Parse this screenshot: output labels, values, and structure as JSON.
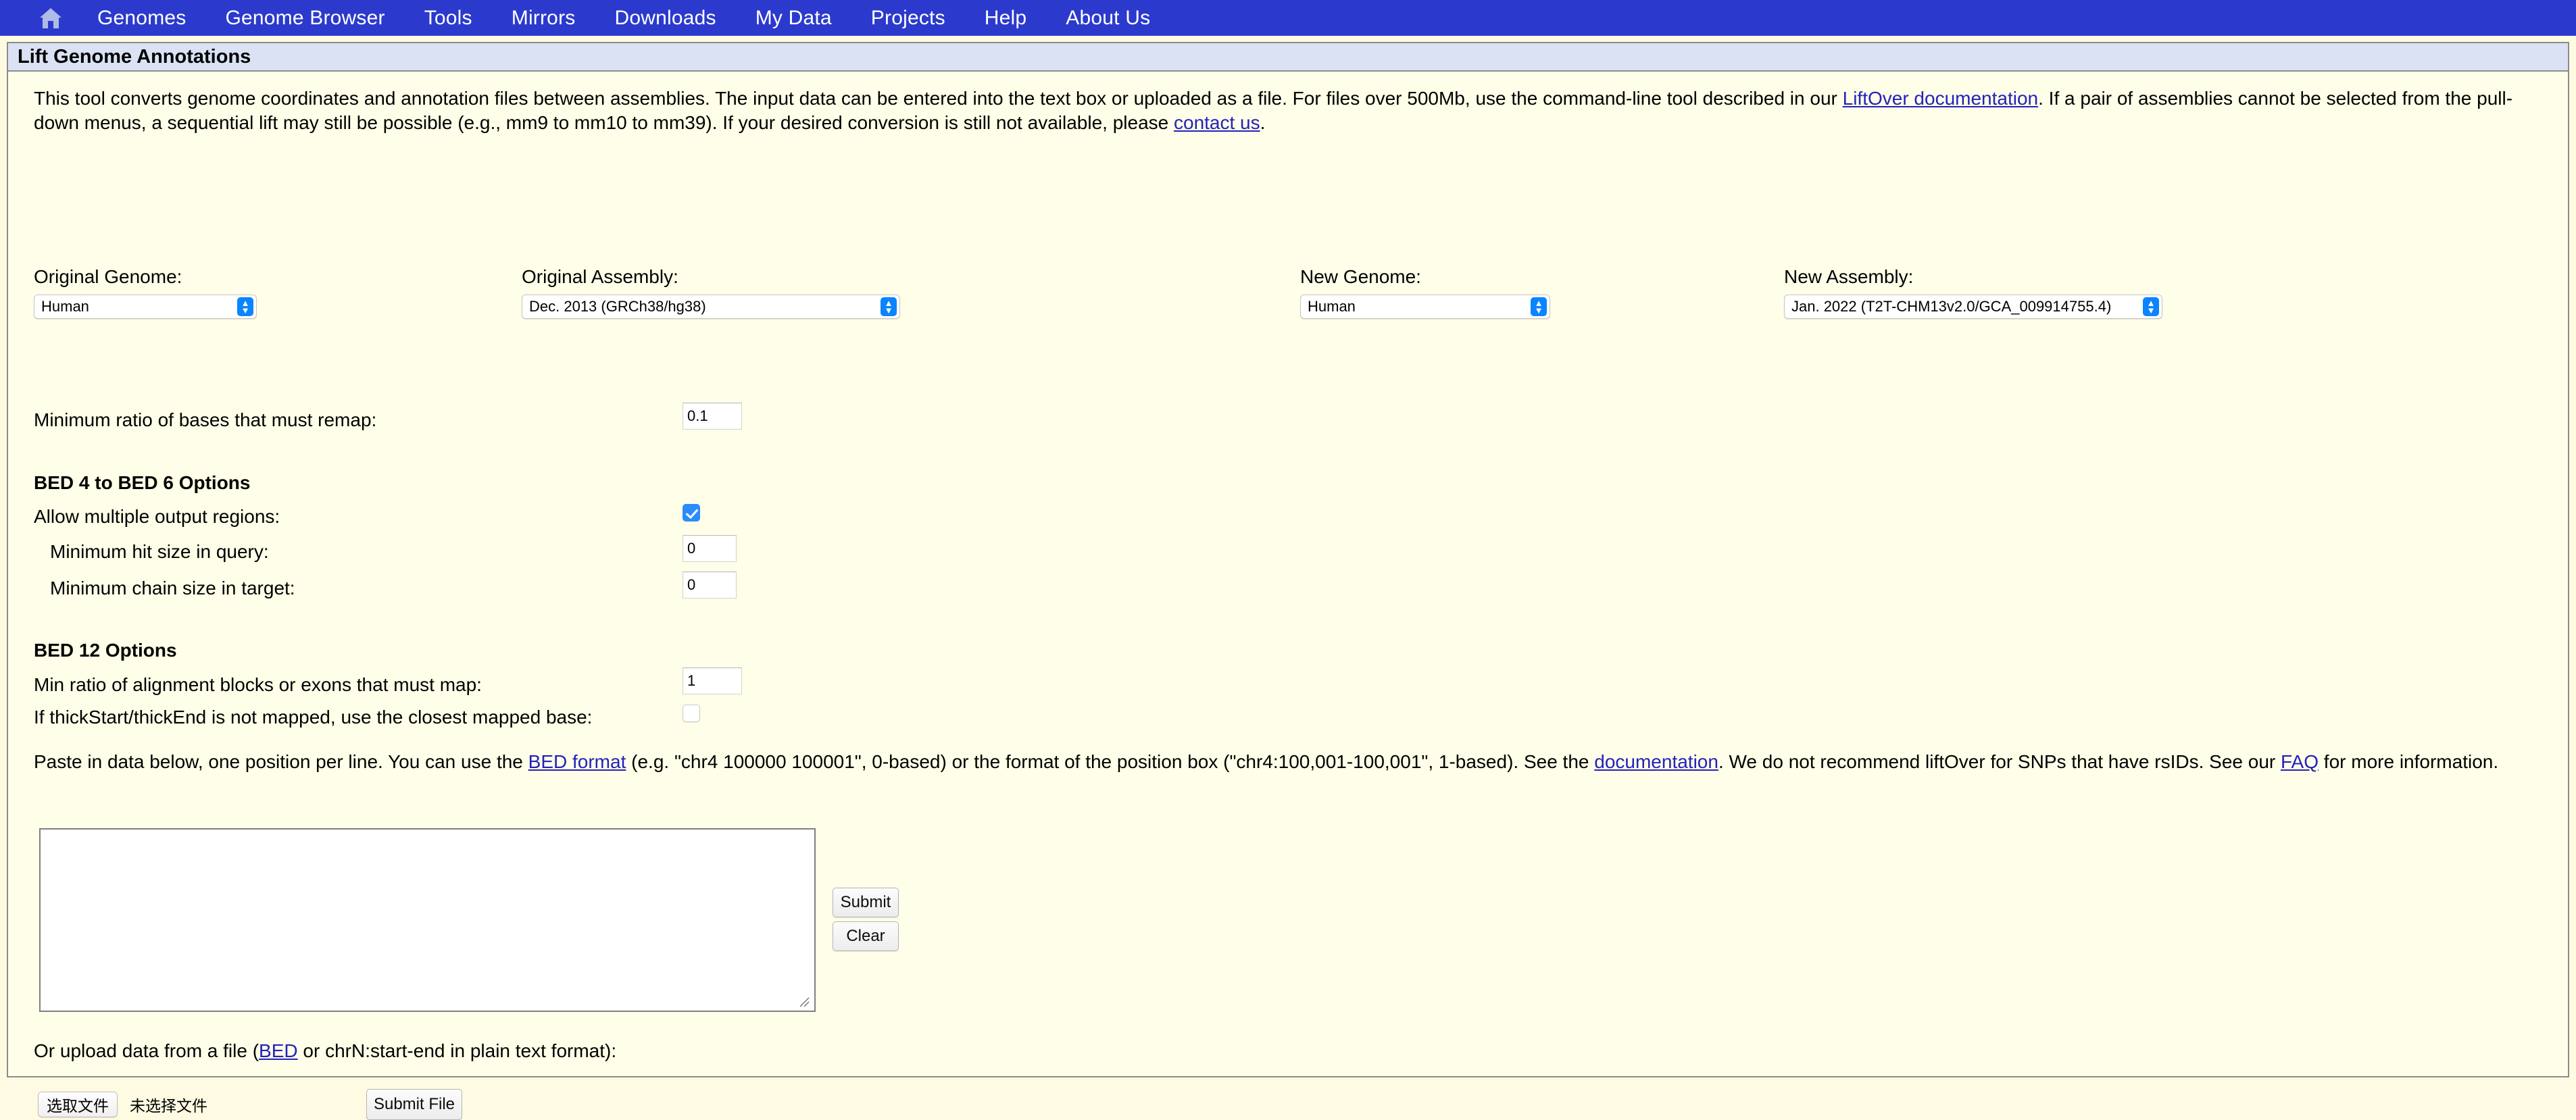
{
  "nav": {
    "home_icon": "home-icon",
    "items": [
      {
        "label": "Genomes"
      },
      {
        "label": "Genome Browser"
      },
      {
        "label": "Tools"
      },
      {
        "label": "Mirrors"
      },
      {
        "label": "Downloads"
      },
      {
        "label": "My Data"
      },
      {
        "label": "Projects"
      },
      {
        "label": "Help"
      },
      {
        "label": "About Us"
      }
    ]
  },
  "page": {
    "title": "Lift Genome Annotations"
  },
  "intro": {
    "t1": "This tool converts genome coordinates and annotation files between assemblies.  The input data can be entered into the text box or uploaded as a file.  For files over 500Mb, use the command-line tool described in our ",
    "link1": "LiftOver documentation",
    "t2": ".  If a pair of assemblies cannot be selected from the pull-down menus, a sequential lift may still be possible (e.g., mm9 to mm10 to mm39).  If your desired conversion is still not available, please ",
    "link2": "contact us",
    "t3": "."
  },
  "selectors": {
    "orig_genome_label": "Original Genome:",
    "orig_genome_value": "Human",
    "orig_assembly_label": "Original Assembly:",
    "orig_assembly_value": "Dec. 2013 (GRCh38/hg38)",
    "new_genome_label": "New Genome:",
    "new_genome_value": "Human",
    "new_assembly_label": "New Assembly:",
    "new_assembly_value": "Jan. 2022 (T2T-CHM13v2.0/GCA_009914755.4)"
  },
  "options": {
    "min_ratio_label": "Minimum ratio of bases that must remap:",
    "min_ratio_value": "0.1",
    "bed46_heading": "BED 4 to BED 6 Options",
    "allow_multi_label": "Allow multiple output regions:",
    "allow_multi_checked": "true",
    "min_hit_label": "Minimum hit size in query:",
    "min_hit_value": "0",
    "min_chain_label": "Minimum chain size in target:",
    "min_chain_value": "0",
    "bed12_heading": "BED 12 Options",
    "min_ratio_aln_label": "Min ratio of alignment blocks or exons that must map:",
    "min_ratio_aln_value": "1",
    "thickstart_label": "If thickStart/thickEnd is not mapped, use the closest mapped base:",
    "thickstart_checked": "false"
  },
  "paste": {
    "t1": "Paste in data below, one position per line. You can use the ",
    "link1": "BED format",
    "t2": " (e.g. \"chr4 100000 100001\", 0-based) or the format of the position box (\"chr4:100,001-100,001\", 1-based). See the ",
    "link2": "documentation",
    "t3": ". We do not recommend liftOver for SNPs that have rsIDs. See our ",
    "link3": "FAQ",
    "t4": " for more information."
  },
  "form": {
    "textarea_value": "",
    "textarea_placeholder": "",
    "submit_label": "Submit",
    "clear_label": "Clear"
  },
  "upload": {
    "t1": "Or upload data from a file (",
    "link1": "BED",
    "t2": " or chrN:start-end in plain text format):",
    "choose_file_label": "选取文件",
    "file_status": "未选择文件",
    "submit_file_label": "Submit File"
  },
  "colors": {
    "nav_blue": "#2B3ACD",
    "page_bg": "#FFFBE2",
    "panel_bg": "#FFFEE8",
    "title_bg": "#DAE2F4",
    "link": "#2222BB",
    "accent_blue": "#0A84FF",
    "border_gray": "#8C8C8C"
  }
}
